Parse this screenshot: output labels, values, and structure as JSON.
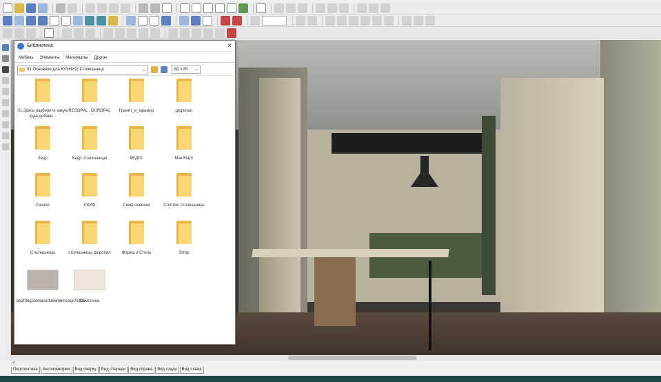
{
  "dialog": {
    "title": "Библиотека",
    "close": "×",
    "tabs": [
      "Мебель",
      "Элементы",
      "Материалы",
      "Другое"
    ],
    "active_tab": "Материалы",
    "path": "01 Основное для КУХНИ2) Столешница",
    "size": "80 x 80",
    "items": [
      {
        "label": "01 Здесь разберите какую куда добави...",
        "kind": "folder"
      },
      {
        "label": "RESOPAL , DUROPAL",
        "kind": "folder"
      },
      {
        "label": "Гранит_и_мрамор",
        "kind": "folder"
      },
      {
        "label": "дюропал",
        "kind": "folder"
      },
      {
        "label": "Кедр",
        "kind": "folder"
      },
      {
        "label": "Кедр столешницы",
        "kind": "folder"
      },
      {
        "label": "КЕДР1",
        "kind": "folder"
      },
      {
        "label": "Мак Март",
        "kind": "folder"
      },
      {
        "label": "Разное",
        "kind": "folder"
      },
      {
        "label": "СКИФ",
        "kind": "folder"
      },
      {
        "label": "Скиф новинки",
        "kind": "folder"
      },
      {
        "label": "Слотекс столешницы",
        "kind": "folder"
      },
      {
        "label": "Столешницы",
        "kind": "folder"
      },
      {
        "label": "столешницы дюропал",
        "kind": "folder"
      },
      {
        "label": "Форма и Стиль",
        "kind": "folder"
      },
      {
        "label": "Эггер",
        "kind": "folder"
      },
      {
        "label": "bq2f3bg2e86ace0b56m6muzgr791bo",
        "kind": "swatch",
        "color": "#b9b2ab"
      },
      {
        "label": "Семолина",
        "kind": "swatch",
        "color": "#ece5d9"
      }
    ]
  },
  "view_tabs": [
    "Перспектива",
    "Аксонометрия",
    "Вид сверху",
    "Вид спереди",
    "Вид справа",
    "Вид сзади",
    "Вид слева"
  ],
  "active_view_tab": "Вид спереди",
  "colors": {
    "folder": "#f8d674",
    "status": "#1f4a44"
  }
}
